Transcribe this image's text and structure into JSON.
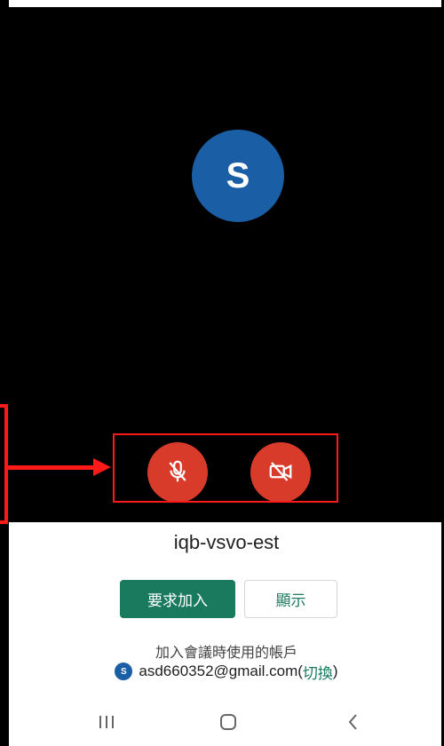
{
  "preview": {
    "avatar_letter": "S"
  },
  "controls": {
    "mic_label": "mic-off",
    "cam_label": "camera-off"
  },
  "meeting": {
    "code": "iqb-vsvo-est"
  },
  "actions": {
    "join_label": "要求加入",
    "show_label": "顯示"
  },
  "account": {
    "caption": "加入會議時使用的帳戶",
    "avatar_letter": "S",
    "email": "asd660352@gmail.com",
    "paren_open": "(",
    "switch_label": "切換",
    "paren_close": ")"
  },
  "colors": {
    "accent_green": "#1a7a5e",
    "avatar_blue": "#1a5fa6",
    "control_red": "#d93b2b",
    "annotation_red": "#ff1a1a"
  }
}
